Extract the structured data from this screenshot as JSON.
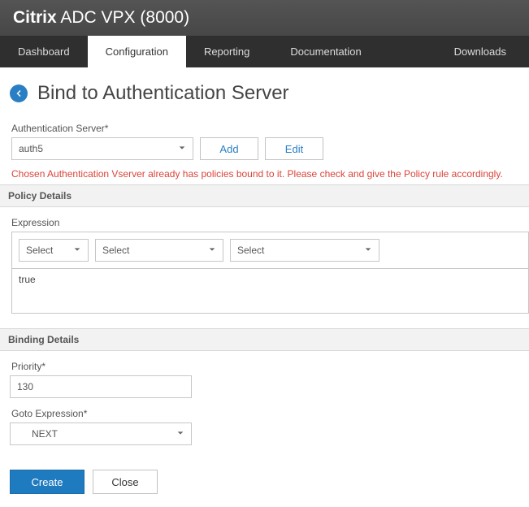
{
  "brand": {
    "bold": "Citrix",
    "light1": " ADC VPX",
    "suffix": " (8000)"
  },
  "nav": {
    "tabs": [
      "Dashboard",
      "Configuration",
      "Reporting",
      "Documentation",
      "Downloads"
    ],
    "active_index": 1
  },
  "page": {
    "title": "Bind to Authentication Server"
  },
  "auth_server": {
    "label": "Authentication Server*",
    "value": "auth5",
    "add_label": "Add",
    "edit_label": "Edit",
    "warning": "Chosen Authentication Vserver already has policies bound to it. Please check and give the Policy rule accordingly."
  },
  "policy_details": {
    "section_label": "Policy Details",
    "expression_label": "Expression",
    "select_placeholder": "Select",
    "expression_value": "true"
  },
  "binding_details": {
    "section_label": "Binding Details",
    "priority_label": "Priority*",
    "priority_value": "130",
    "goto_label": "Goto Expression*",
    "goto_value": "NEXT"
  },
  "footer": {
    "create_label": "Create",
    "close_label": "Close"
  }
}
